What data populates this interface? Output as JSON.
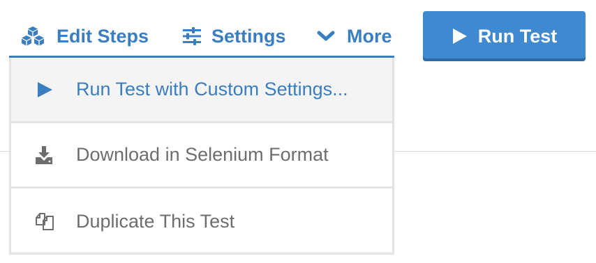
{
  "toolbar": {
    "edit_steps": {
      "label": "Edit Steps",
      "icon": "cubes-icon"
    },
    "settings": {
      "label": "Settings",
      "icon": "sliders-icon"
    },
    "more": {
      "label": "More",
      "icon": "chevron-down-icon"
    },
    "run_test": {
      "label": "Run Test",
      "icon": "play-icon"
    }
  },
  "dropdown": {
    "items": [
      {
        "label": "Run Test with Custom Settings...",
        "icon": "play-icon",
        "active": true
      },
      {
        "label": "Download in Selenium Format",
        "icon": "download-icon",
        "active": false
      },
      {
        "label": "Duplicate This Test",
        "icon": "copy-icon",
        "active": false
      }
    ]
  },
  "colors": {
    "accent": "#3a7ec1",
    "button_bg": "#3e89cf",
    "menu_text": "#6d6d6d",
    "active_bg": "#f4f4f4",
    "border": "#e3e3e3"
  }
}
